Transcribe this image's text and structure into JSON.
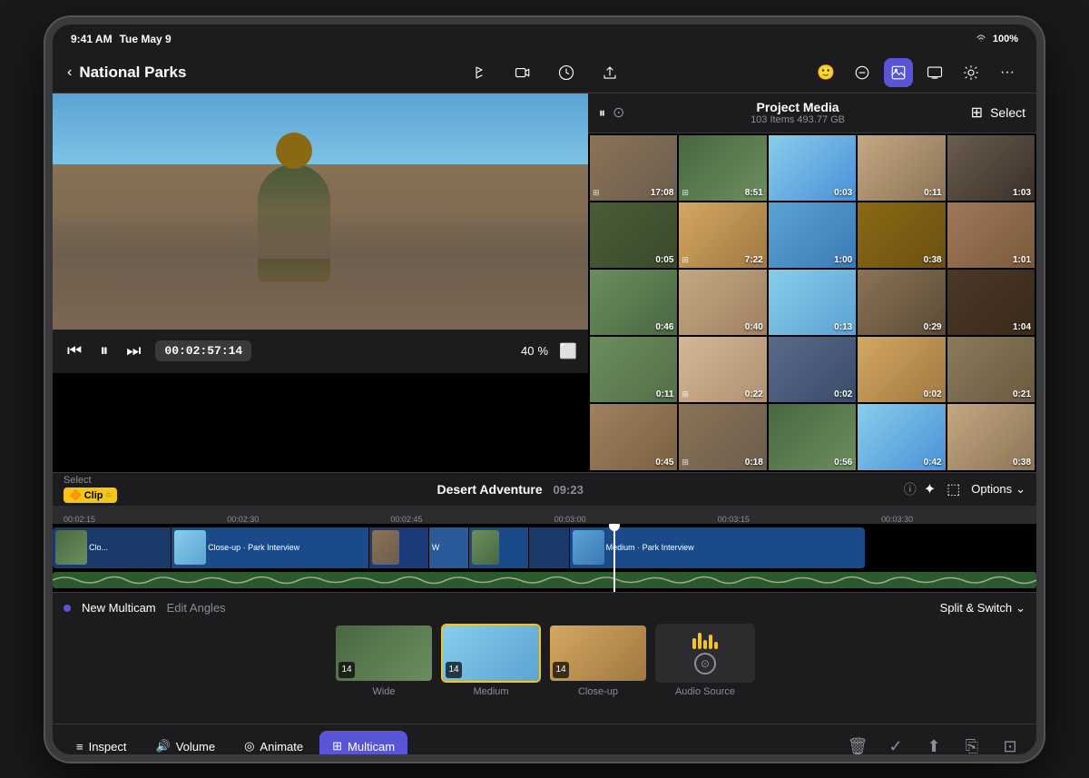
{
  "status_bar": {
    "time": "9:41 AM",
    "date": "Tue May 9",
    "wifi": "100%",
    "battery": "100%"
  },
  "nav": {
    "back_label": "‹",
    "title": "National Parks",
    "icons": [
      "share",
      "video",
      "star",
      "export"
    ],
    "right_icons": [
      "face",
      "minus",
      "photo",
      "display",
      "brightness",
      "more"
    ]
  },
  "media_browser": {
    "title": "Project Media",
    "subtitle": "103 Items  493.77 GB",
    "select_label": "Select",
    "thumbs": [
      {
        "duration": "17:08",
        "color_class": "t1"
      },
      {
        "duration": "8:51",
        "color_class": "t2"
      },
      {
        "duration": "0:03",
        "color_class": "t3"
      },
      {
        "duration": "0:11",
        "color_class": "t4"
      },
      {
        "duration": "1:03",
        "color_class": "t5"
      },
      {
        "duration": "0:05",
        "color_class": "t6"
      },
      {
        "duration": "7:22",
        "color_class": "t7"
      },
      {
        "duration": "1:00",
        "color_class": "t8"
      },
      {
        "duration": "0:38",
        "color_class": "t9"
      },
      {
        "duration": "1:01",
        "color_class": "t10"
      },
      {
        "duration": "0:46",
        "color_class": "t11"
      },
      {
        "duration": "0:40",
        "color_class": "t12"
      },
      {
        "duration": "0:13",
        "color_class": "t13"
      },
      {
        "duration": "0:29",
        "color_class": "t14"
      },
      {
        "duration": "1:04",
        "color_class": "t15"
      },
      {
        "duration": "0:11",
        "color_class": "t16"
      },
      {
        "duration": "0:22",
        "color_class": "t17"
      },
      {
        "duration": "0:02",
        "color_class": "t18"
      },
      {
        "duration": "0:02",
        "color_class": "t7"
      },
      {
        "duration": "0:21",
        "color_class": "t19"
      },
      {
        "duration": "0:45",
        "color_class": "t20"
      },
      {
        "duration": "0:18",
        "color_class": "t1"
      },
      {
        "duration": "0:56",
        "color_class": "t2"
      },
      {
        "duration": "0:42",
        "color_class": "t3"
      },
      {
        "duration": "0:38",
        "color_class": "t4"
      }
    ]
  },
  "video": {
    "timecode": "00:02:57:14",
    "zoom": "40"
  },
  "timeline": {
    "select_label": "Select",
    "clip_label": "Clip",
    "project_name": "Desert Adventure",
    "duration": "09:23",
    "ruler_marks": [
      "00:02:15",
      "00:02:30",
      "00:02:45",
      "00:03:00",
      "00:03:15",
      "00:03:30"
    ],
    "segments": [
      {
        "label": "Clo...",
        "width": "15%",
        "color": "#1a4a8a"
      },
      {
        "label": "Close-up · Park Interview",
        "width": "22%",
        "color": "#2a5a9a"
      },
      {
        "label": "",
        "width": "8%",
        "color": "#1a4a8a"
      },
      {
        "label": "W...",
        "width": "5%",
        "color": "#2a5a9a"
      },
      {
        "label": "",
        "width": "8%",
        "color": "#1a4a8a"
      },
      {
        "label": "Medium · Park Interview",
        "width": "30%",
        "color": "#2a5a9a"
      }
    ]
  },
  "multicam": {
    "label": "New Multicam",
    "edit_angles": "Edit Angles",
    "split_switch": "Split & Switch",
    "angles": [
      {
        "name": "Wide",
        "num": "14",
        "active": false,
        "color_class": "t2"
      },
      {
        "name": "Medium",
        "num": "14",
        "active": true,
        "color_class": "t13"
      },
      {
        "name": "Close-up",
        "num": "14",
        "active": false,
        "color_class": "t7"
      },
      {
        "name": "Audio Source",
        "type": "audio"
      }
    ]
  },
  "toolbar": {
    "inspect_label": "Inspect",
    "volume_label": "Volume",
    "animate_label": "Animate",
    "multicam_label": "Multicam",
    "active": "multicam"
  }
}
